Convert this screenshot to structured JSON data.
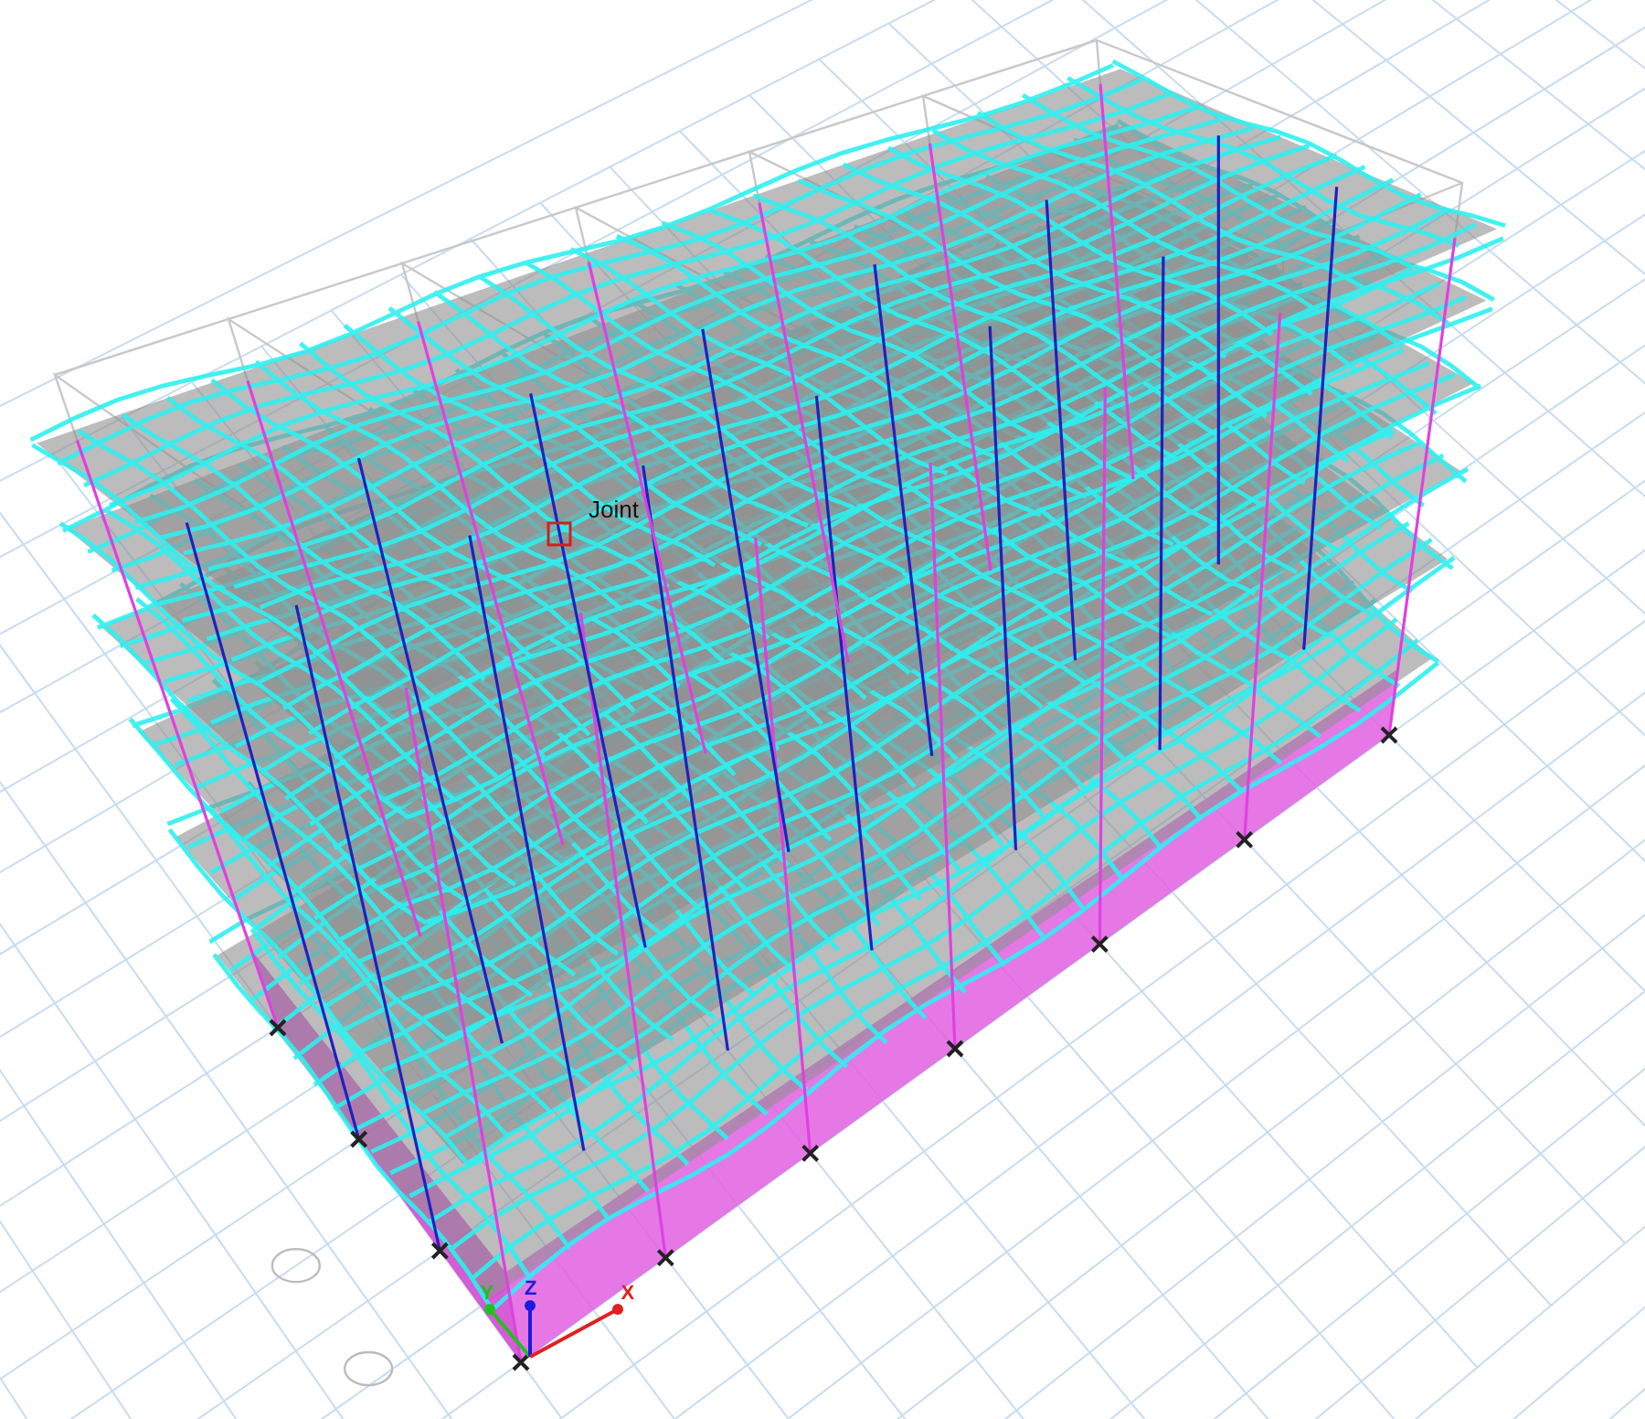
{
  "viewport": {
    "joint_label": "Joint",
    "axes": [
      {
        "kind": "y",
        "label": "Y"
      },
      {
        "kind": "z",
        "label": "Z"
      },
      {
        "kind": "x",
        "label": "X"
      }
    ]
  }
}
